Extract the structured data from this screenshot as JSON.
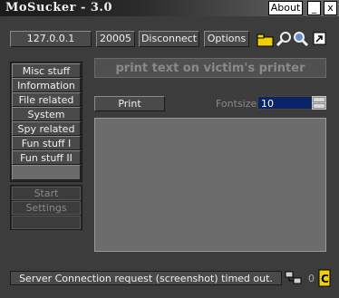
{
  "window": {
    "title": "MoSucker - 3.0"
  },
  "titlebar": {
    "about_label": "About",
    "minimize_label": "_",
    "close_label": "x"
  },
  "toolbar": {
    "ip": "127.0.0.1",
    "port": "20005",
    "disconnect_label": "Disconnect",
    "options_label": "Options"
  },
  "sidebar": {
    "items": [
      {
        "label": "Misc stuff"
      },
      {
        "label": "Information"
      },
      {
        "label": "File related"
      },
      {
        "label": "System"
      },
      {
        "label": "Spy related"
      },
      {
        "label": "Fun stuff I"
      },
      {
        "label": "Fun stuff II"
      },
      {
        "label": ""
      }
    ],
    "secondary": [
      {
        "label": "Start"
      },
      {
        "label": "Settings"
      },
      {
        "label": ""
      }
    ]
  },
  "main": {
    "header": "print text on victim's printer",
    "print_label": "Print",
    "fontsize_label": "Fontsize",
    "fontsize_value": "10",
    "text_value": ""
  },
  "statusbar": {
    "message": "Server Connection request (screenshot) timed out.",
    "count": "0"
  },
  "colors": {
    "background": "#3c3c3c",
    "selection": "#0a246a",
    "accent": "#f0d000"
  }
}
